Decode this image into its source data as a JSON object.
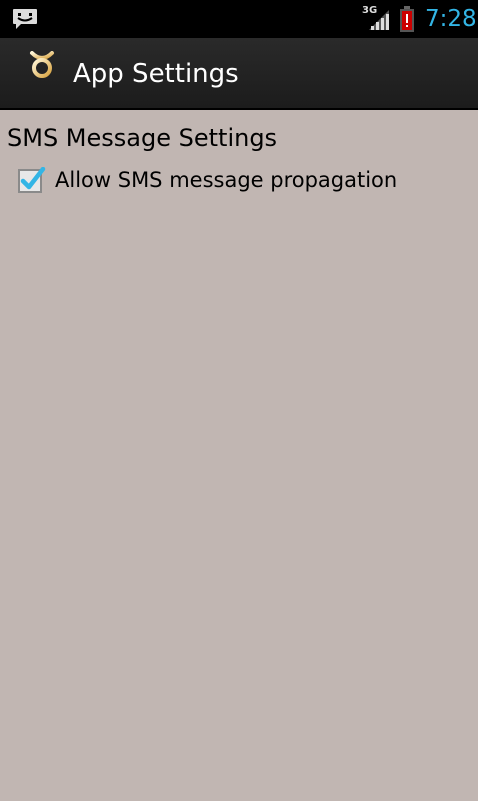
{
  "status_bar": {
    "notification_icon": "sms-notification-icon",
    "network_type": "3G",
    "signal_icon": "signal-strength-icon",
    "battery_icon": "battery-alert-icon",
    "time": "7:28",
    "time_color": "#33b5e5"
  },
  "action_bar": {
    "icon": "mercury-symbol-icon",
    "title": "App Settings"
  },
  "settings": {
    "category_title": "SMS Message Settings",
    "items": [
      {
        "label": "Allow SMS message propagation",
        "checked": true
      }
    ]
  },
  "colors": {
    "background": "#c1b6b2",
    "action_bar": "#222222",
    "checkbox_check": "#33b5e5",
    "battery_alert": "#cc0000"
  }
}
